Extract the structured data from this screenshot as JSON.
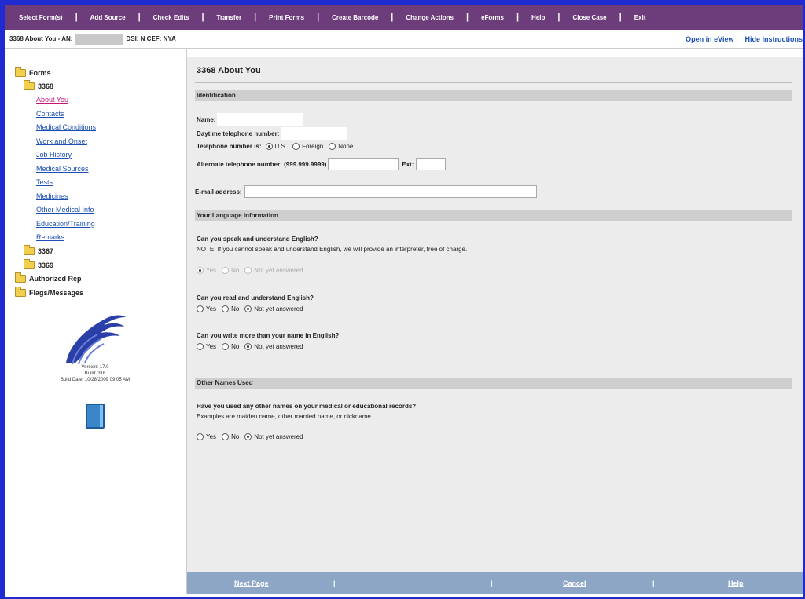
{
  "menu": [
    "Select Form(s)",
    "Add Source",
    "Check Edits",
    "Transfer",
    "Print Forms",
    "Create Barcode",
    "Change Actions",
    "eForms",
    "Help",
    "Close Case",
    "Exit"
  ],
  "infobar": {
    "title": "3368 About You - AN:",
    "mid": "DSI: N  CEF: NYA",
    "open_eview": "Open in eView",
    "hide_instructions": "Hide Instructions"
  },
  "tree": {
    "forms": "Forms",
    "f3368": "3368",
    "links": [
      "About You",
      "Contacts",
      "Medical Conditions",
      "Work and Onset",
      "Job History",
      "Medical Sources",
      "Tests",
      "Medicines",
      "Other Medical Info",
      "Education/Training",
      "Remarks"
    ],
    "f3367": "3367",
    "f3369": "3369",
    "authorized_rep": "Authorized Rep",
    "flags": "Flags/Messages"
  },
  "version": {
    "line1": "Version: 17.0",
    "line2": "Build: 316",
    "line3": "Build Date: 10/28/2009 09:05 AM"
  },
  "main": {
    "title": "3368 About You",
    "sec_identification": "Identification",
    "name_label": "Name:",
    "day_phone_label": "Daytime telephone number:",
    "phone_is_label": "Telephone number is:",
    "phone_options": [
      "U.S.",
      "Foreign",
      "None"
    ],
    "alt_phone_label": "Alternate telephone number: (999.999.9999)",
    "ext_label": "Ext:",
    "email_label": "E-mail address:",
    "sec_language": "Your Language Information",
    "q_speak": "Can you speak and understand English?",
    "q_speak_note": "NOTE: If you cannot speak and understand English, we will provide an interpreter, free of charge.",
    "q_read": "Can you read and understand English?",
    "q_write": "Can you write more than your name in English?",
    "answer_options": [
      "Yes",
      "No",
      "Not yet answered"
    ],
    "sec_other_names": "Other Names Used",
    "q_other_names": "Have you used any other names on your medical or educational records?",
    "q_other_names_note": "Examples are maiden name, other married name, or nickname"
  },
  "footer": {
    "next": "Next Page",
    "cancel": "Cancel",
    "help": "Help"
  },
  "colors": {
    "menubar": "#6c3d7a",
    "frame": "#1f2bd0",
    "footer": "#8ea6c6",
    "link": "#1b4fb3",
    "active_link": "#c2187a"
  }
}
